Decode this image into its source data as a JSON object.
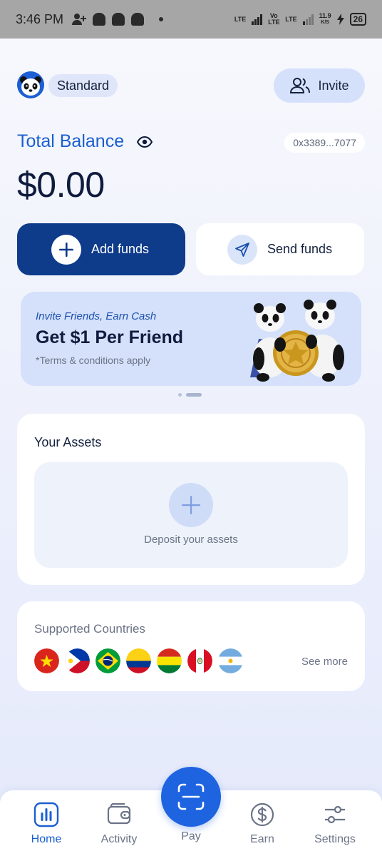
{
  "status_bar": {
    "time": "3:46 PM",
    "network_1": "LTE",
    "network_2": "Vo LTE",
    "network_3": "LTE",
    "speed": "11.9",
    "speed_unit": "K/S",
    "battery": "26"
  },
  "header": {
    "plan_label": "Standard",
    "invite_label": "Invite"
  },
  "balance": {
    "label": "Total Balance",
    "amount": "$0.00",
    "address": "0x3389...7077"
  },
  "actions": {
    "add_funds": "Add funds",
    "send_funds": "Send funds"
  },
  "promo_banner": {
    "subtitle": "Invite Friends, Earn Cash",
    "title": "Get $1 Per Friend",
    "terms": "*Terms & conditions apply",
    "carousel_active_index": 1,
    "carousel_count": 2
  },
  "assets": {
    "title": "Your Assets",
    "deposit_label": "Deposit your assets"
  },
  "countries": {
    "title": "Supported Countries",
    "see_more": "See more",
    "flags": [
      "vietnam-flag-icon",
      "philippines-flag-icon",
      "brazil-flag-icon",
      "colombia-flag-icon",
      "bolivia-flag-icon",
      "peru-flag-icon",
      "argentina-flag-icon"
    ]
  },
  "tab_bar": {
    "home": "Home",
    "activity": "Activity",
    "pay": "Pay",
    "earn": "Earn",
    "settings": "Settings",
    "active_tab": "Home"
  },
  "colors": {
    "accent": "#1a5fd0",
    "primary_button": "#0e3b8a",
    "pay_button": "#1e63e0"
  }
}
